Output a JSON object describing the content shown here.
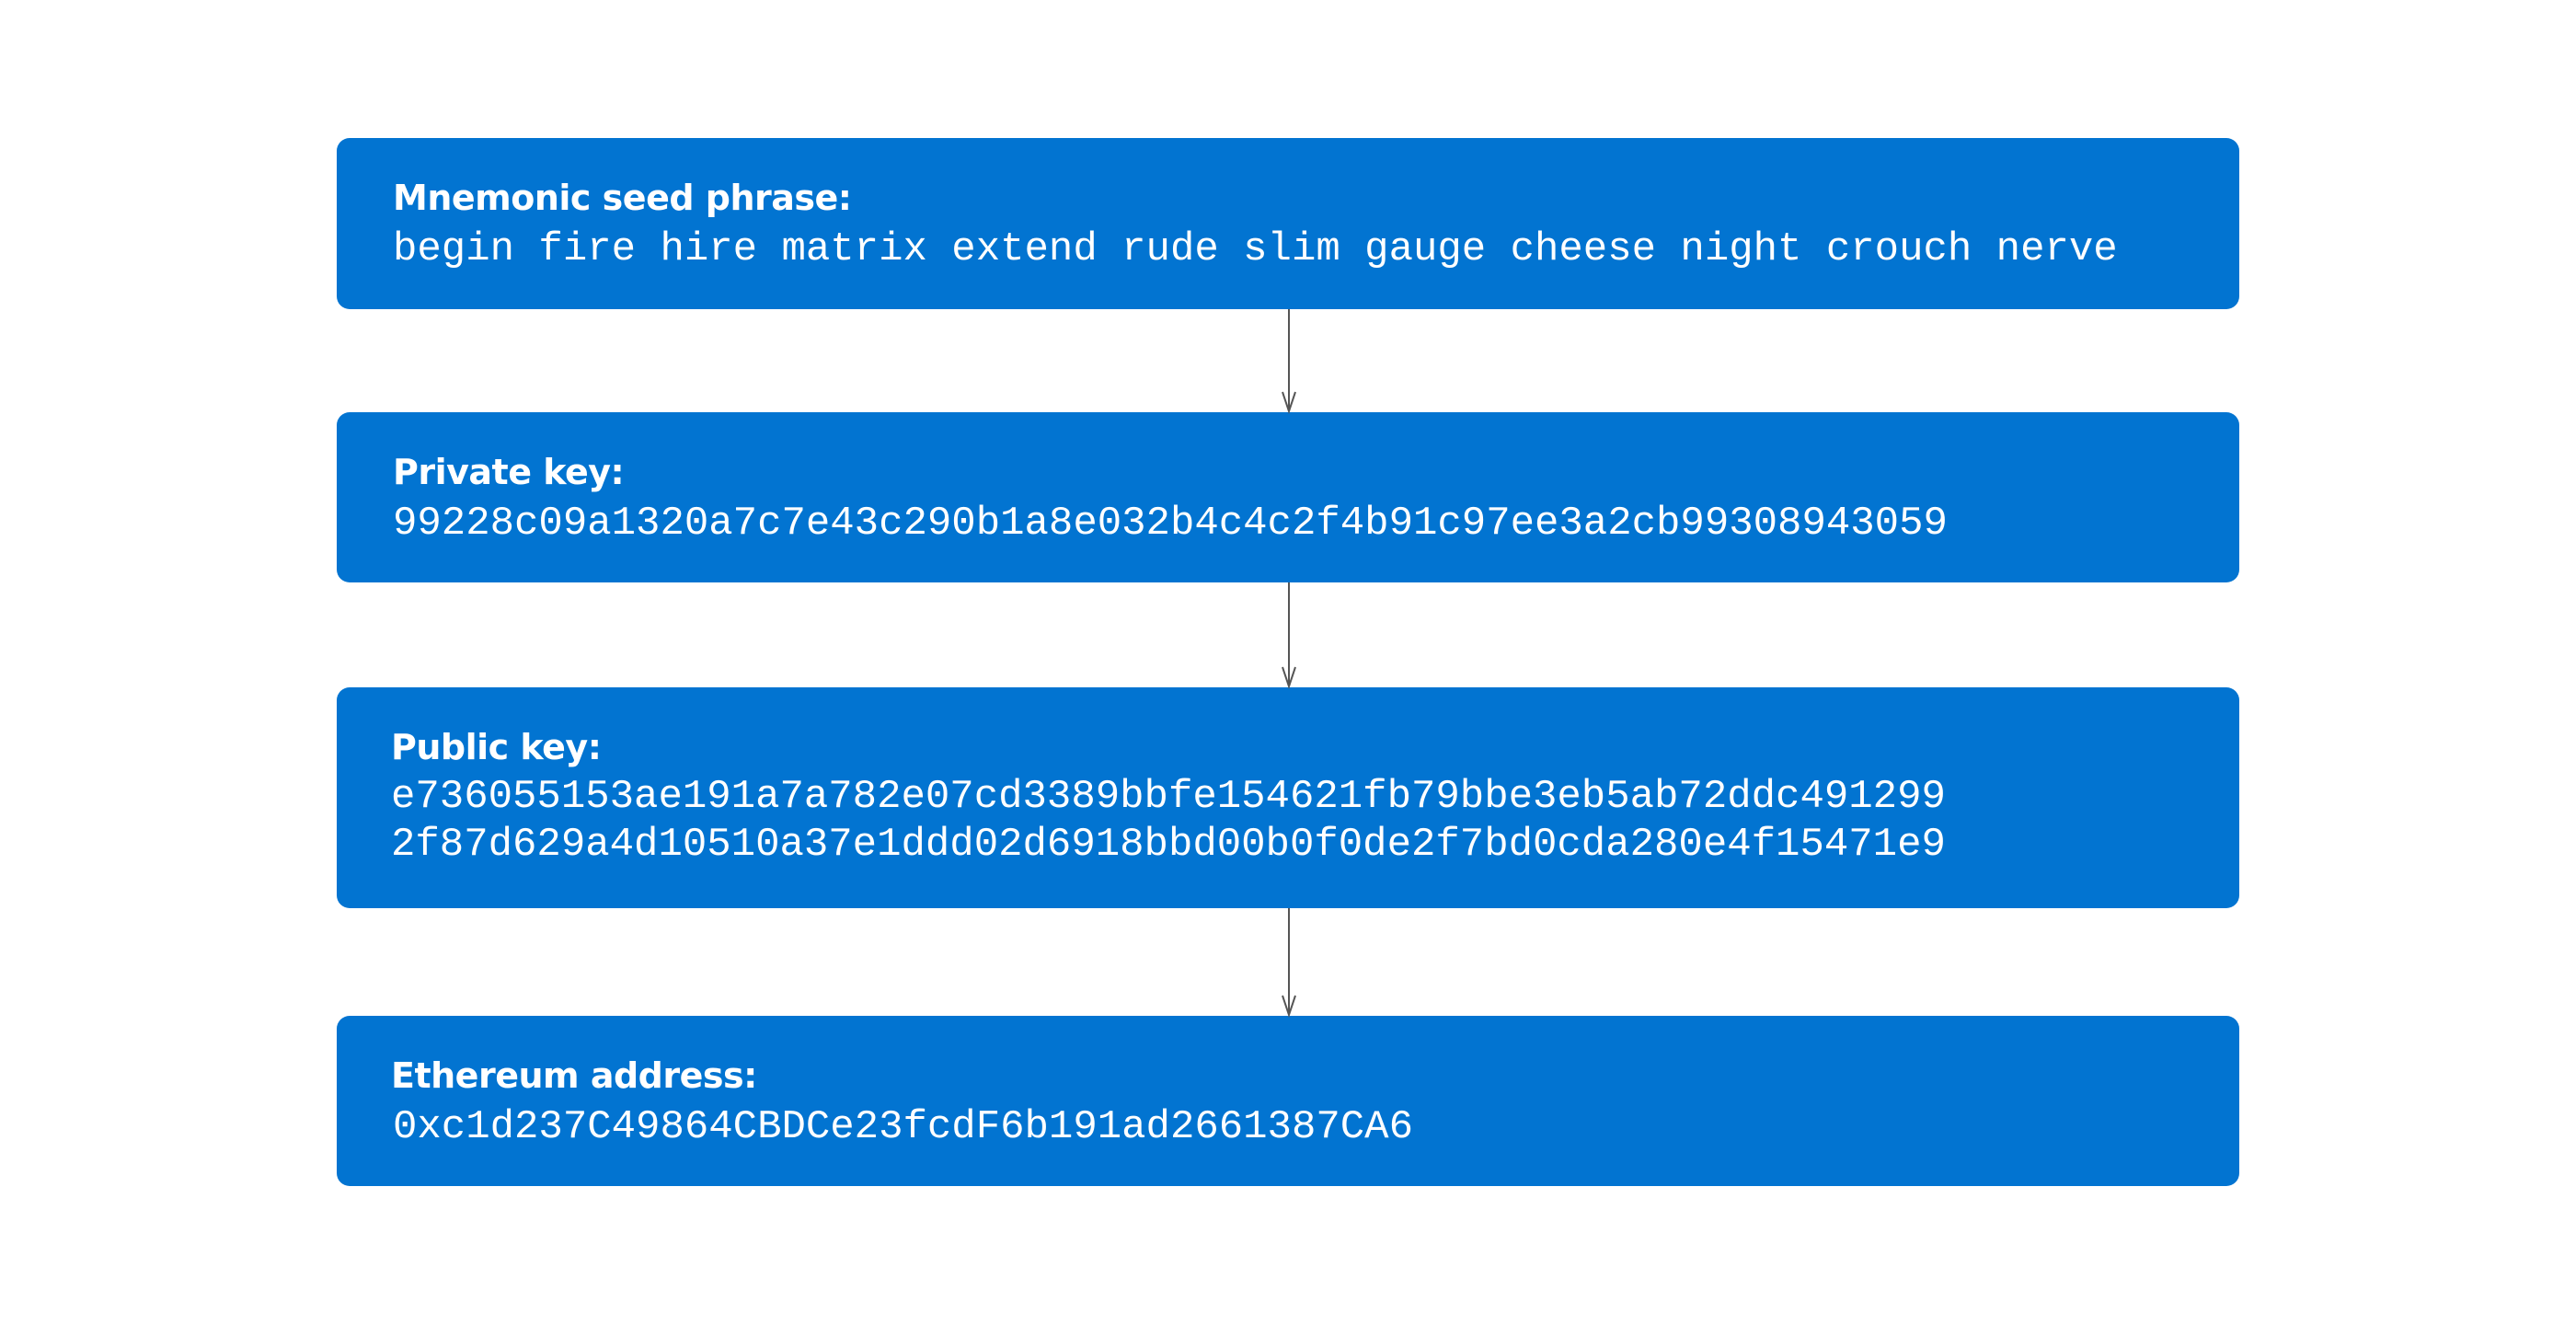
{
  "diagram": {
    "nodes": [
      {
        "id": "mnemonic",
        "title": "Mnemonic seed phrase:",
        "lines": [
          "begin fire hire matrix extend rude slim gauge cheese night crouch nerve"
        ]
      },
      {
        "id": "private-key",
        "title": "Private key:",
        "lines": [
          "99228c09a1320a7c7e43c290b1a8e032b4c4c2f4b91c97ee3a2cb99308943059"
        ]
      },
      {
        "id": "public-key",
        "title": "Public key:",
        "lines": [
          "e736055153ae191a7a782e07cd3389bbfe154621fb79bbe3eb5ab72ddc491299",
          "2f87d629a4d10510a37e1ddd02d6918bbd00b0f0de2f7bd0cda280e4f15471e9"
        ]
      },
      {
        "id": "ethereum-address",
        "title": "Ethereum address:",
        "lines": [
          "0xc1d237C49864CBDCe23fcdF6b191ad2661387CA6"
        ]
      }
    ],
    "edges": [
      {
        "from": "mnemonic",
        "to": "private-key"
      },
      {
        "from": "private-key",
        "to": "public-key"
      },
      {
        "from": "public-key",
        "to": "ethereum-address"
      }
    ],
    "colors": {
      "box": "#0274D1",
      "text": "#ffffff",
      "arrow": "#555555"
    }
  }
}
